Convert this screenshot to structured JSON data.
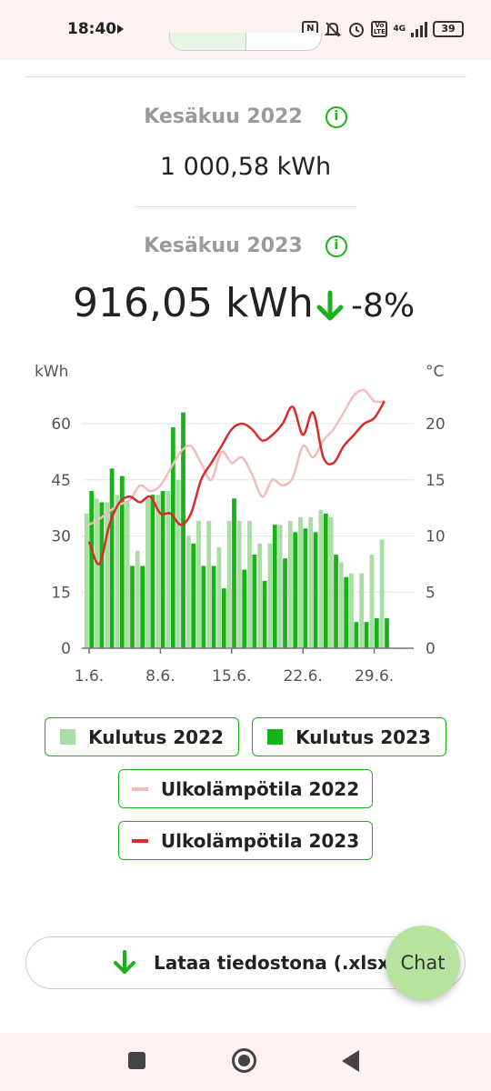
{
  "status_bar": {
    "time": "18:40",
    "network": "4G",
    "battery": "39",
    "icons": [
      "play-icon",
      "nfc-icon",
      "mute-icon",
      "alarm-icon",
      "volte-icon",
      "signal-icon",
      "battery-icon"
    ]
  },
  "summary": {
    "previous": {
      "label": "Kesäkuu 2022",
      "value": "1 000,58 kWh"
    },
    "current": {
      "label": "Kesäkuu 2023",
      "value": "916,05 kWh",
      "change": "-8%",
      "change_direction": "down"
    }
  },
  "colors": {
    "accent_green": "#19b219",
    "bar_2022": "#a8dea3",
    "bar_2023": "#17b417",
    "line_2022": "#f2bcbc",
    "line_2023": "#d82b2b",
    "chat_fab": "#b6e39d"
  },
  "chart_data": {
    "type": "bar",
    "left_axis": {
      "unit": "kWh",
      "ticks": [
        "60",
        "45",
        "30",
        "15",
        "0"
      ],
      "ylim": [
        0,
        60
      ]
    },
    "right_axis": {
      "unit": "°C",
      "ticks": [
        "20",
        "15",
        "10",
        "5",
        "0"
      ],
      "ylim": [
        0,
        20
      ]
    },
    "x_ticks": [
      {
        "day": 1,
        "label": "1.6."
      },
      {
        "day": 8,
        "label": "8.6."
      },
      {
        "day": 15,
        "label": "15.6."
      },
      {
        "day": 22,
        "label": "22.6."
      },
      {
        "day": 29,
        "label": "29.6."
      }
    ],
    "days": [
      1,
      2,
      3,
      4,
      5,
      6,
      7,
      8,
      9,
      10,
      11,
      12,
      13,
      14,
      15,
      16,
      17,
      18,
      19,
      20,
      21,
      22,
      23,
      24,
      25,
      26,
      27,
      28,
      29,
      30
    ],
    "series": [
      {
        "name": "Kulutus 2022",
        "kind": "bar",
        "axis": "left",
        "values": [
          36,
          40,
          39,
          41,
          39,
          26,
          40,
          41,
          42,
          45,
          30,
          34,
          34,
          27,
          34,
          34,
          34,
          28,
          28,
          33,
          34,
          35,
          35,
          37,
          35,
          23,
          20,
          20,
          25,
          29
        ]
      },
      {
        "name": "Kulutus 2023",
        "kind": "bar",
        "axis": "left",
        "values": [
          42,
          39,
          48,
          46,
          22,
          22,
          41,
          42,
          59,
          63,
          28,
          22,
          22,
          16,
          40,
          21,
          25,
          18,
          33,
          24,
          31,
          32,
          31,
          36,
          25,
          19,
          7,
          7,
          8,
          8
        ]
      },
      {
        "name": "Ulkolämpötila 2022",
        "kind": "line",
        "axis": "right",
        "values": [
          11,
          11.5,
          12.2,
          12.8,
          13.2,
          14.5,
          14,
          14.5,
          16,
          17.5,
          18,
          16.5,
          15,
          17.5,
          16.5,
          17,
          15.5,
          13.5,
          15,
          14.5,
          15.2,
          18,
          17,
          18.5,
          19.5,
          21,
          22.5,
          23,
          22,
          22
        ]
      },
      {
        "name": "Ulkolämpötila 2023",
        "kind": "line",
        "axis": "right",
        "values": [
          9.5,
          7.5,
          11,
          13,
          13.5,
          13,
          13.5,
          12,
          12,
          11,
          12,
          15,
          16.5,
          18,
          19.5,
          20,
          19.5,
          18.5,
          19,
          20,
          21.5,
          19,
          21,
          17,
          16.5,
          18,
          19,
          20,
          20.5,
          22
        ]
      }
    ]
  },
  "legend": [
    {
      "label": "Kulutus 2022",
      "swatch": "square",
      "color": "#a8dea3"
    },
    {
      "label": "Kulutus 2023",
      "swatch": "square",
      "color": "#17b417"
    },
    {
      "label": "Ulkolämpötila 2022",
      "swatch": "line",
      "color": "#f2bcbc"
    },
    {
      "label": "Ulkolämpötila 2023",
      "swatch": "line",
      "color": "#d82b2b"
    }
  ],
  "download": {
    "label": "Lataa tiedostona (.xlsx)"
  },
  "chat": {
    "label": "Chat"
  }
}
